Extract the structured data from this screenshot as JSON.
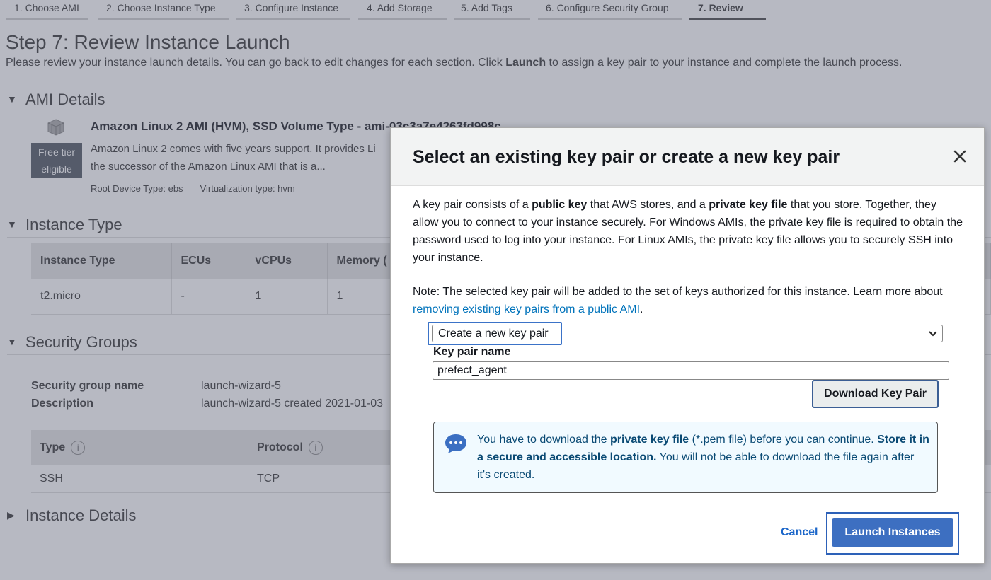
{
  "wizard": {
    "tabs": [
      {
        "label": "1. Choose AMI"
      },
      {
        "label": "2. Choose Instance Type"
      },
      {
        "label": "3. Configure Instance"
      },
      {
        "label": "4. Add Storage"
      },
      {
        "label": "5. Add Tags"
      },
      {
        "label": "6. Configure Security Group"
      },
      {
        "label": "7. Review"
      }
    ],
    "active_tab": "7. Review"
  },
  "page": {
    "title": "Step 7: Review Instance Launch",
    "description_pre": "Please review your instance launch details. You can go back to edit changes for each section. Click ",
    "description_bold": "Launch",
    "description_post": " to assign a key pair to your instance and complete the launch process."
  },
  "ami": {
    "section_title": "AMI Details",
    "name": "Amazon Linux 2 AMI (HVM), SSD Volume Type - ami-03c3a7e4263fd998c",
    "badge": "Free tier eligible",
    "desc_line1": "Amazon Linux 2 comes with five years support. It provides Li",
    "desc_line2": "the successor of the Amazon Linux AMI that is a...",
    "root_device": "Root Device Type: ebs",
    "virtualization": "Virtualization type: hvm"
  },
  "instance_type": {
    "section_title": "Instance Type",
    "headers": [
      "Instance Type",
      "ECUs",
      "vCPUs",
      "Memory ("
    ],
    "row": [
      "t2.micro",
      "-",
      "1",
      "1"
    ]
  },
  "security_groups": {
    "section_title": "Security Groups",
    "name_label": "Security group name",
    "name_value": "launch-wizard-5",
    "desc_label": "Description",
    "desc_value": "launch-wizard-5 created 2021-01-03",
    "headers": [
      "Type",
      "Protocol"
    ],
    "row": [
      "SSH",
      "TCP"
    ]
  },
  "instance_details": {
    "section_title": "Instance Details"
  },
  "modal": {
    "title": "Select an existing key pair or create a new key pair",
    "body_1": "A key pair consists of a ",
    "body_2": "public key",
    "body_3": " that AWS stores, and a ",
    "body_4": "private key file",
    "body_5": " that you store. Together, they allow you to connect to your instance securely. For Windows AMIs, the private key file is required to obtain the password used to log into your instance. For Linux AMIs, the private key file allows you to securely SSH into your instance.",
    "note_pre": "Note: The selected key pair will be added to the set of keys authorized for this instance. Learn more about ",
    "note_link": "removing existing key pairs from a public AMI",
    "note_post": ".",
    "select_value": "Create a new key pair",
    "key_pair_label": "Key pair name",
    "key_pair_value": "prefect_agent",
    "download_label": "Download Key Pair",
    "alert_1": "You have to download the ",
    "alert_2": "private key file",
    "alert_3": " (*.pem file) before you can continue. ",
    "alert_4": "Store it in a secure and accessible location.",
    "alert_5": " You will not be able to download the file again after it's created.",
    "cancel_label": "Cancel",
    "launch_label": "Launch Instances"
  },
  "colors": {
    "accent": "#3d6fc1",
    "link": "#0073bb",
    "alert_bg": "#f1faff",
    "alert_text": "#0a4a74"
  }
}
